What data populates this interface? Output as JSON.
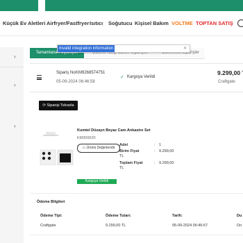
{
  "nav": {
    "items": [
      "Küçük Ev Aletleri",
      "Airfryer/Fastfryer",
      "Isıtıcı",
      "Soğutucu",
      "Kişisel Bakım",
      "VOLTME",
      "TOPTAN SATIŞ"
    ]
  },
  "tooltip": {
    "text": "Invalid integration information"
  },
  "tabs": [
    "Tamamlanan Siparişler",
    "Ödeme Talep Edilen Siparişler",
    "Ödenmesi Siparişler"
  ],
  "order": {
    "number_label": "Sipariş No",
    "number": "KM9268574751",
    "date": "05-09-2024 06:46:58",
    "status": "Kargoya Verildi",
    "total": "9.299,00 T",
    "seller": "Craftgate",
    "reorder_label": "Siparişi Tekrarla"
  },
  "product": {
    "name": "Kumtel Düzayn Beyaz Cam Ankastre Set",
    "code": "KM300620",
    "review_label": "Ürünü Değerlendir",
    "qty_label": "Adet",
    "qty_sep": ":",
    "qty": "1",
    "unit_price_label": "Birim Fiyat",
    "unit_price": "9.299,00",
    "currency": "TL",
    "total_price_label": "Toplam Fiyat",
    "total_price": "9.299,00",
    "delivered_label": "Kargoya Verildi"
  },
  "payment": {
    "title": "Ödeme Bilgileri",
    "headers": [
      "Ödeme Tipi:",
      "Ödeme Tutarı:",
      "Tarih:",
      "Du"
    ],
    "row": [
      "Craftgate",
      "9.299,00 TL",
      "05-09-2024 06:46:67",
      "On"
    ]
  },
  "colors": {
    "brand_green": "#1d8f6b",
    "accent_red": "#e0262b",
    "accent_orange": "#f07b1a",
    "badge_green": "#1faa55",
    "highlight_blue": "#2f6fd8"
  }
}
